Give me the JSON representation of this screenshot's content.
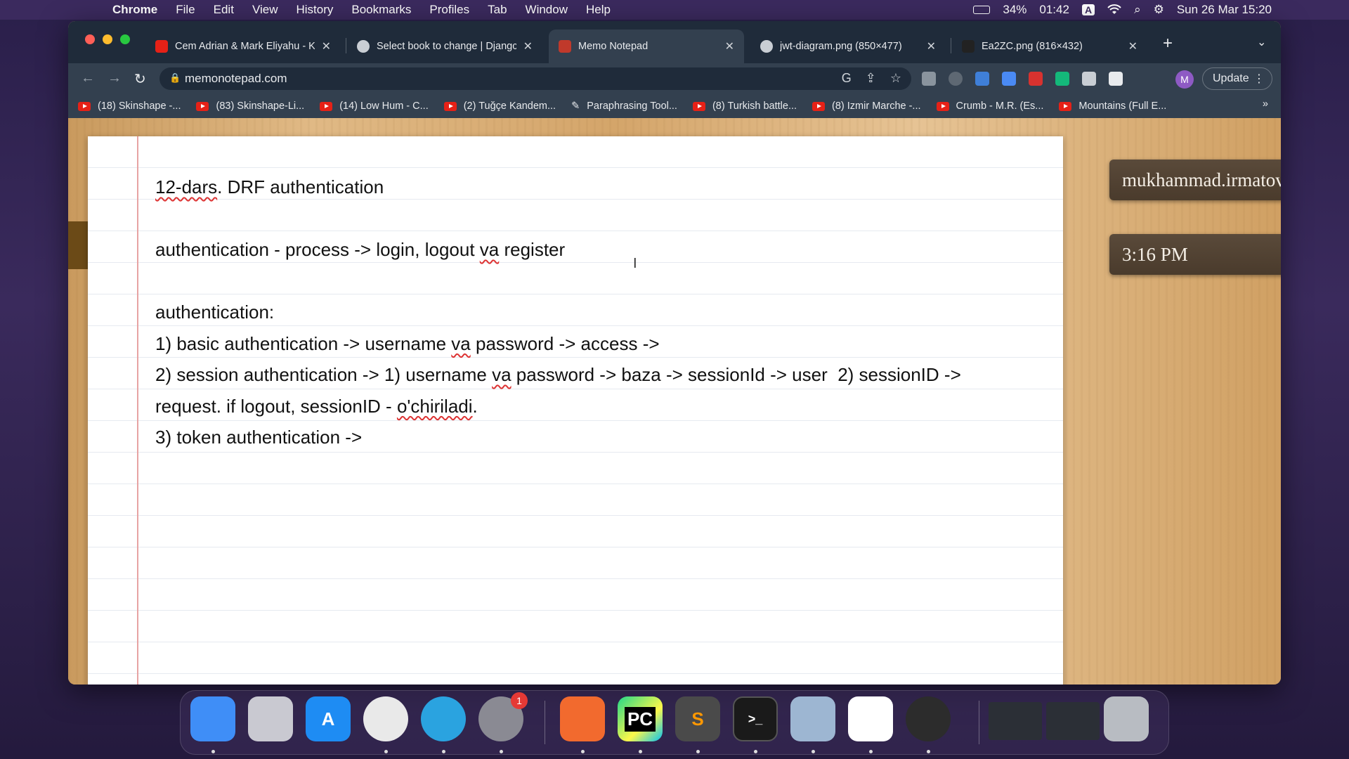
{
  "menubar": {
    "app": "Chrome",
    "menus": [
      "File",
      "Edit",
      "View",
      "History",
      "Bookmarks",
      "Profiles",
      "Tab",
      "Window",
      "Help"
    ],
    "battery": "34%",
    "time_left": "01:42",
    "input_source": "A",
    "datetime": "Sun 26 Mar  15:20"
  },
  "tabs": [
    {
      "title": "Cem Adrian & Mark Eliyahu - K",
      "icon": "youtube-icon",
      "active": false
    },
    {
      "title": "Select book to change | Djangc",
      "icon": "globe-icon",
      "active": false
    },
    {
      "title": "Memo Notepad",
      "icon": "notepad-icon",
      "active": true
    },
    {
      "title": "jwt-diagram.png (850×477)",
      "icon": "globe-icon",
      "active": false
    },
    {
      "title": "Ea2ZC.png (816×432)",
      "icon": "image-icon",
      "active": false
    }
  ],
  "address": {
    "url": "memonotepad.com"
  },
  "profile": {
    "initial": "M"
  },
  "update_label": "Update",
  "bookmarks": [
    {
      "label": "(18) Skinshape -...",
      "icon": "youtube-icon"
    },
    {
      "label": "(83) Skinshape-Li...",
      "icon": "youtube-icon"
    },
    {
      "label": "(14) Low Hum - C...",
      "icon": "youtube-icon"
    },
    {
      "label": "(2) Tuğçe Kandem...",
      "icon": "youtube-icon"
    },
    {
      "label": "Paraphrasing Tool...",
      "icon": "quill-icon"
    },
    {
      "label": "(8) Turkish battle...",
      "icon": "youtube-icon"
    },
    {
      "label": "(8) Izmir Marche -...",
      "icon": "youtube-icon"
    },
    {
      "label": "Crumb - M.R. (Es...",
      "icon": "youtube-icon"
    },
    {
      "label": "Mountains (Full E...",
      "icon": "youtube-icon"
    }
  ],
  "notes": {
    "lines": [
      [
        {
          "t": "12-dars",
          "s": true
        },
        {
          "t": ". DRF authentication",
          "s": false
        }
      ],
      [],
      [
        {
          "t": "authentication - process -> login, logout ",
          "s": false
        },
        {
          "t": "va",
          "s": true
        },
        {
          "t": " register",
          "s": false
        }
      ],
      [],
      [
        {
          "t": "authentication:",
          "s": false
        }
      ],
      [
        {
          "t": "1) basic authentication -> username ",
          "s": false
        },
        {
          "t": "va",
          "s": true
        },
        {
          "t": " password -> access ->",
          "s": false
        }
      ],
      [
        {
          "t": "2) session authentication -> 1) username ",
          "s": false
        },
        {
          "t": "va",
          "s": true
        },
        {
          "t": " password -> baza -> sessionId -> user  2) sessionID ->",
          "s": false
        }
      ],
      [
        {
          "t": "request. if logout, sessionID - ",
          "s": false
        },
        {
          "t": "o'chiriladi",
          "s": true
        },
        {
          "t": ".",
          "s": false
        }
      ],
      [
        {
          "t": "3) token authentication ->",
          "s": false
        }
      ]
    ]
  },
  "side": {
    "user": "mukhammad.irmatov",
    "clock": "3:16 PM"
  },
  "dock": [
    {
      "name": "finder-icon",
      "color": "#3f8ef7",
      "label": ""
    },
    {
      "name": "launchpad-icon",
      "color": "#c9c9d1",
      "label": ""
    },
    {
      "name": "app-store-icon",
      "color": "#1e8cf3",
      "label": "A"
    },
    {
      "name": "chrome-icon",
      "color": "#e9e9e9",
      "label": ""
    },
    {
      "name": "telegram-icon",
      "color": "#2aa3e0",
      "label": ""
    },
    {
      "name": "system-settings-icon",
      "color": "#8a8a93",
      "label": "",
      "badge": "1"
    },
    {
      "name": "pen-app-icon",
      "color": "#f26a2e",
      "label": ""
    },
    {
      "name": "pycharm-icon",
      "color": "#21d789",
      "label": "PC"
    },
    {
      "name": "sublime-text-icon",
      "color": "#4a4a4a",
      "label": "S"
    },
    {
      "name": "terminal-icon",
      "color": "#1a1a1a",
      "label": ">_"
    },
    {
      "name": "pgadmin-icon",
      "color": "#9db6d2",
      "label": ""
    },
    {
      "name": "slack-icon",
      "color": "#ffffff",
      "label": ""
    },
    {
      "name": "obs-icon",
      "color": "#2c2c2c",
      "label": ""
    },
    {
      "name": "pycharm-window-1",
      "color": "#2b2f36",
      "label": ""
    },
    {
      "name": "pycharm-window-2",
      "color": "#2b2f36",
      "label": ""
    },
    {
      "name": "trash-icon",
      "color": "#b8bcc2",
      "label": ""
    }
  ]
}
